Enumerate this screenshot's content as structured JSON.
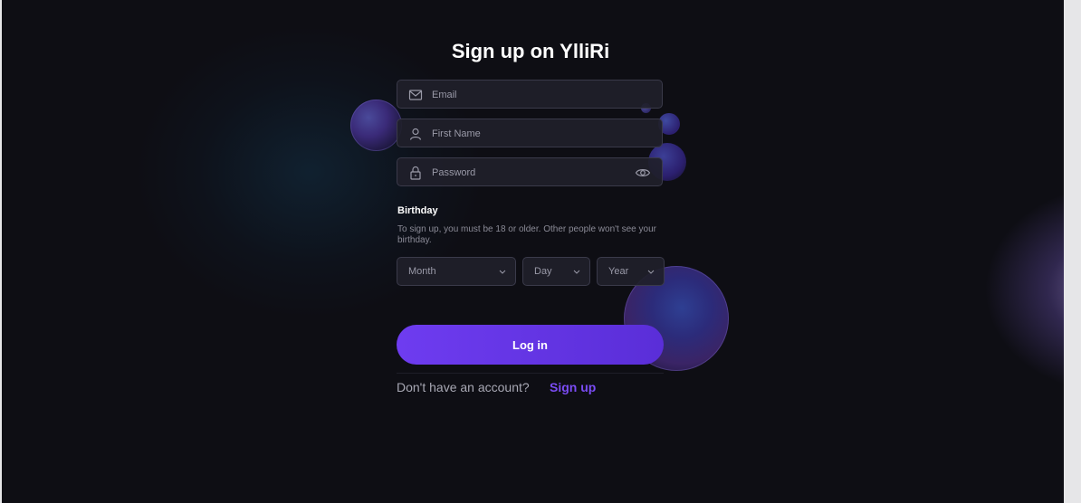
{
  "title": "Sign up on YlliRi",
  "form": {
    "email_placeholder": "Email",
    "first_name_placeholder": "First Name",
    "password_placeholder": "Password"
  },
  "birthday": {
    "title": "Birthday",
    "note": "To sign up, you must be 18 or older. Other people won't see your birthday.",
    "month_label": "Month",
    "day_label": "Day",
    "year_label": "Year"
  },
  "login_button": "Log in",
  "footer": {
    "prompt": "Don't have an account?",
    "link": "Sign up"
  },
  "colors": {
    "background": "#0e0e14",
    "accent": "#6e3cf0",
    "link": "#7b4cf5"
  }
}
